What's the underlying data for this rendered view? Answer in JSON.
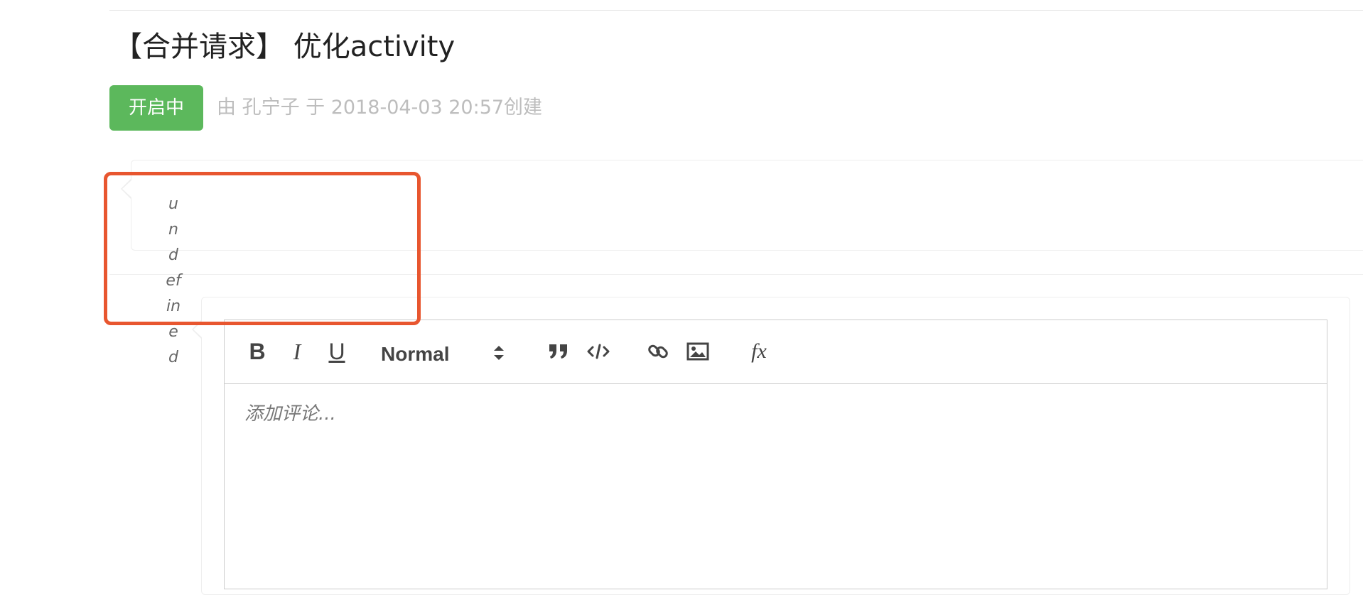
{
  "header": {
    "title": "【合并请求】 优化activity",
    "status_badge": "开启中",
    "meta": "由 孔宁子 于 2018-04-03 20:57创建"
  },
  "activity": {
    "author_placeholder": "undefined"
  },
  "editor": {
    "toolbar": {
      "bold_label": "B",
      "italic_label": "I",
      "underline_label": "U",
      "format_selected": "Normal",
      "blockquote_icon": "blockquote-icon",
      "code_icon": "code-icon",
      "link_icon": "link-icon",
      "image_icon": "image-icon",
      "formula_label": "fx"
    },
    "placeholder": "添加评论..."
  },
  "colors": {
    "status_green": "#5cb85c",
    "highlight_red": "#e8562f",
    "meta_gray": "#bdbdbd"
  }
}
